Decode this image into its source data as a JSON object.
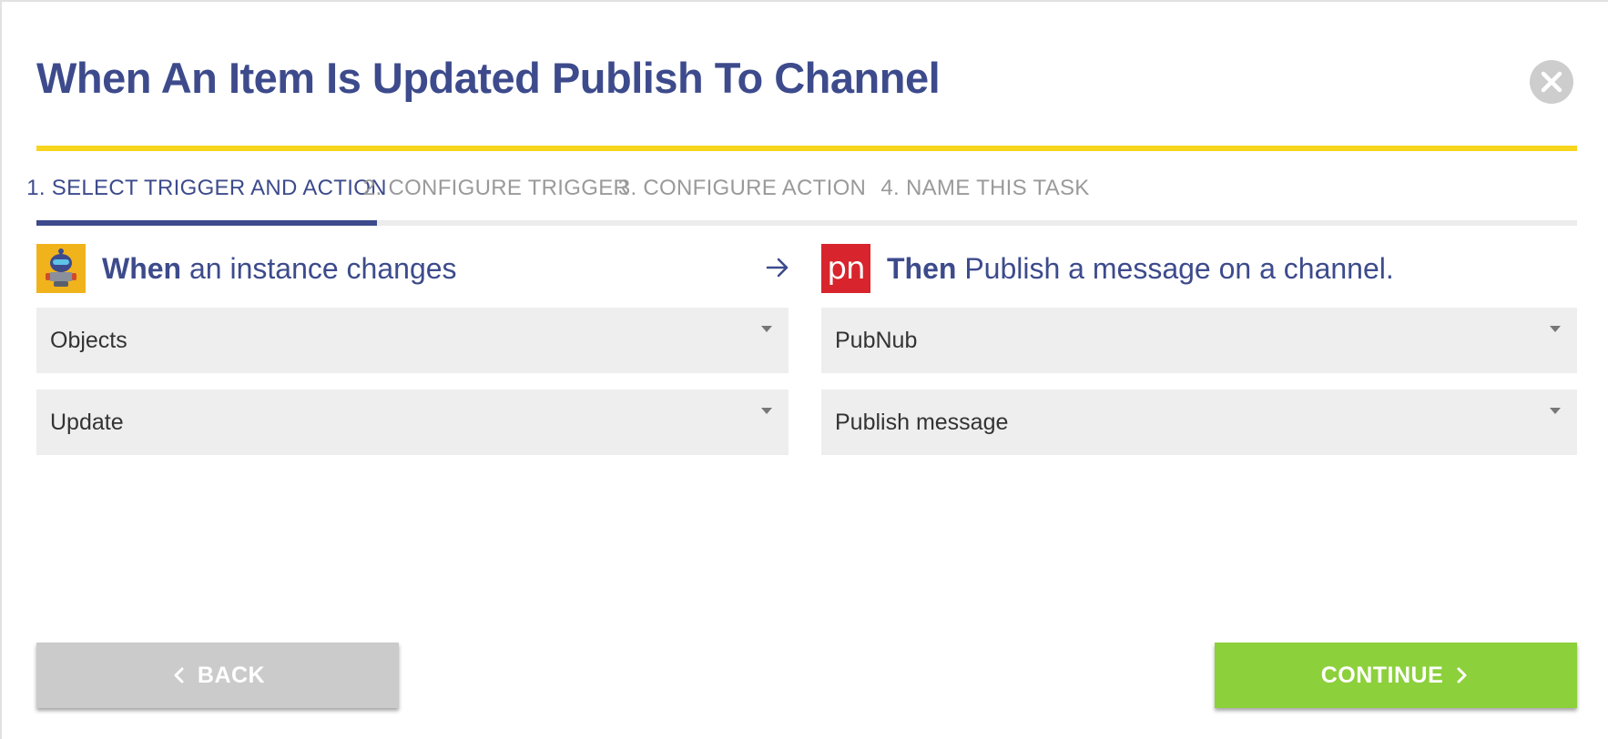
{
  "dialog": {
    "title": "When An Item Is Updated Publish To Channel",
    "close_icon": "close-icon"
  },
  "tabs": [
    {
      "label": "1. SELECT TRIGGER AND ACTION",
      "active": true
    },
    {
      "label": "2. CONFIGURE TRIGGER",
      "active": false
    },
    {
      "label": "3. CONFIGURE ACTION",
      "active": false
    },
    {
      "label": "4. NAME THIS TASK",
      "active": false
    }
  ],
  "trigger": {
    "logo_icon": "robot-logo-icon",
    "keyword": "When",
    "description": " an instance changes",
    "app_select": "Objects",
    "event_select": "Update"
  },
  "arrow_icon": "arrow-right-icon",
  "action": {
    "logo_text": "pn",
    "keyword": "Then",
    "description": " Publish a message on a channel.",
    "app_select": "PubNub",
    "event_select": "Publish message"
  },
  "footer": {
    "back_label": "BACK",
    "continue_label": "CONTINUE"
  },
  "colors": {
    "primary": "#3d4b8c",
    "accent_yellow": "#f7d51d",
    "continue_green": "#8cd03b",
    "back_gray": "#cbcbcb",
    "pubnub_red": "#d8242c",
    "robot_yellow": "#f1b31c"
  }
}
